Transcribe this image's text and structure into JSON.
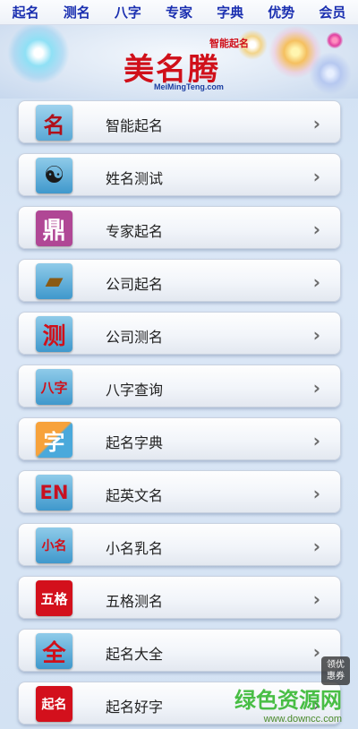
{
  "nav": [
    "起名",
    "测名",
    "八字",
    "专家",
    "字典",
    "优势",
    "会员"
  ],
  "banner": {
    "logo_text": "美名腾",
    "logo_tagline": "智能起名",
    "logo_url": "MeiMingTeng.com"
  },
  "menu": [
    {
      "label": "智能起名",
      "icon_text": "名",
      "icon": "name-pen-icon",
      "bg": "#6bb3d8",
      "fg": "#b0101a"
    },
    {
      "label": "姓名测试",
      "icon_text": "☯",
      "icon": "yin-yang-icon",
      "bg": "#4da7d5",
      "fg": "#1a1a1a"
    },
    {
      "label": "专家起名",
      "icon_text": "鼎",
      "icon": "ding-seal-icon",
      "bg": "#b04795",
      "fg": "#ffffff"
    },
    {
      "label": "公司起名",
      "icon_text": "▰",
      "icon": "book-icon",
      "bg": "#4ea6d6",
      "fg": "#8a5a14"
    },
    {
      "label": "公司测名",
      "icon_text": "测",
      "icon": "ce-icon",
      "bg": "#46a7d9",
      "fg": "#d0101a"
    },
    {
      "label": "八字查询",
      "icon_text": "八字",
      "icon": "bazi-icon",
      "bg": "#4aa9db",
      "fg": "#d0101a"
    },
    {
      "label": "起名字典",
      "icon_text": "字",
      "icon": "dictionary-icon",
      "bg": "#4aa9db",
      "fg": "#ffffff"
    },
    {
      "label": "起英文名",
      "icon_text": "EN",
      "icon": "english-icon",
      "bg": "#4aa9db",
      "fg": "#c81020"
    },
    {
      "label": "小名乳名",
      "icon_text": "小名",
      "icon": "nickname-icon",
      "bg": "#4aa9db",
      "fg": "#d0101a"
    },
    {
      "label": "五格测名",
      "icon_text": "五格",
      "icon": "wuge-icon",
      "bg": "#d3101c",
      "fg": "#ffffff"
    },
    {
      "label": "起名大全",
      "icon_text": "全",
      "icon": "encyclopedia-icon",
      "bg": "#4aa9db",
      "fg": "#d0101a"
    },
    {
      "label": "起名好字",
      "icon_text": "起名",
      "icon": "good-name-icon",
      "bg": "#d3101c",
      "fg": "#ffffff"
    }
  ],
  "coupon": {
    "line1": "领优",
    "line2": "惠券"
  },
  "watermark": {
    "main": "绿色资源网",
    "url": "www.downcc.com"
  },
  "colors": {
    "nav_text": "#1a2fb0",
    "accent_red": "#d0101a"
  }
}
